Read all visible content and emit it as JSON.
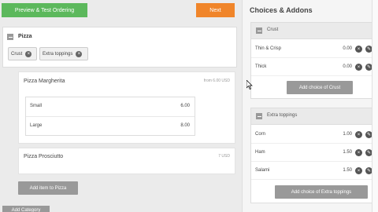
{
  "toolbar": {
    "preview_label": "Preview & Test Ordering",
    "next_label": "Next"
  },
  "category": {
    "title": "Pizza",
    "tags": [
      "Crust",
      "Extra toppings"
    ]
  },
  "items": [
    {
      "name": "Pizza Margherita",
      "price": "from 6.00 USD",
      "sizes": [
        {
          "name": "Small",
          "price": "6.00"
        },
        {
          "name": "Large",
          "price": "8.00"
        }
      ]
    },
    {
      "name": "Pizza Prosciutto",
      "price": "7 USD"
    }
  ],
  "add_item_label": "Add item to Pizza",
  "bottom_button_label": "Add Category",
  "addons_panel": {
    "title": "Choices & Addons",
    "groups": [
      {
        "label": "Crust",
        "choices": [
          {
            "name": "Thin & Crisp",
            "price": "0.00"
          },
          {
            "name": "Thick",
            "price": "0.00"
          }
        ],
        "add_label": "Add choice of Crust"
      },
      {
        "label": "Extra toppings",
        "choices": [
          {
            "name": "Corn",
            "price": "1.00"
          },
          {
            "name": "Ham",
            "price": "1.50"
          },
          {
            "name": "Salami",
            "price": "1.50"
          }
        ],
        "add_label": "Add choice of Extra toppings"
      }
    ]
  },
  "icons": {
    "collapse": "minus-square-icon",
    "remove": "x-circle-icon",
    "edit": "pencil-icon"
  },
  "colors": {
    "primary_green": "#5cb85c",
    "accent_orange": "#f0852a",
    "button_grey": "#999999"
  }
}
